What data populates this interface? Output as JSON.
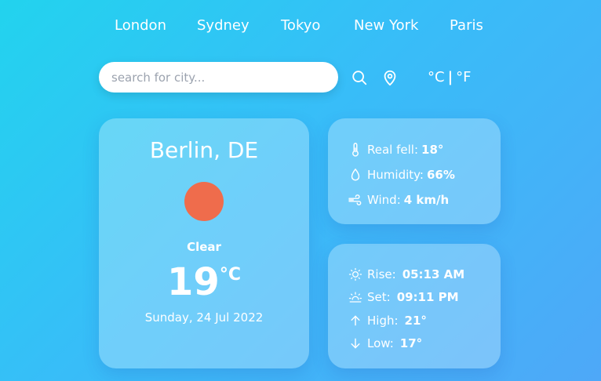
{
  "nav": {
    "cities": [
      "London",
      "Sydney",
      "Tokyo",
      "New York",
      "Paris"
    ]
  },
  "search": {
    "placeholder": "search for city...",
    "search_icon": "search-icon",
    "location_icon": "location-pin-icon"
  },
  "units": {
    "celsius": "°C",
    "separator": "|",
    "fahrenheit": "°F"
  },
  "current": {
    "location": "Berlin, DE",
    "condition_icon": "sun-icon",
    "condition": "Clear",
    "temperature": "19",
    "unit": "°C",
    "date": "Sunday, 24 Jul 2022"
  },
  "details": {
    "real_feel_label": "Real fell:",
    "real_feel_value": "18°",
    "humidity_label": "Humidity:",
    "humidity_value": "66%",
    "wind_label": "Wind:",
    "wind_value": "4 km/h"
  },
  "sun": {
    "rise_label": "Rise:",
    "rise_value": "05:13 AM",
    "set_label": "Set:",
    "set_value": "09:11 PM",
    "high_label": "High:",
    "high_value": "21°",
    "low_label": "Low:",
    "low_value": "17°"
  },
  "colors": {
    "background_start": "#22d3ee",
    "background_end": "#4ea8f8",
    "sun_disc": "#ef6c4c",
    "text": "#ffffff"
  }
}
